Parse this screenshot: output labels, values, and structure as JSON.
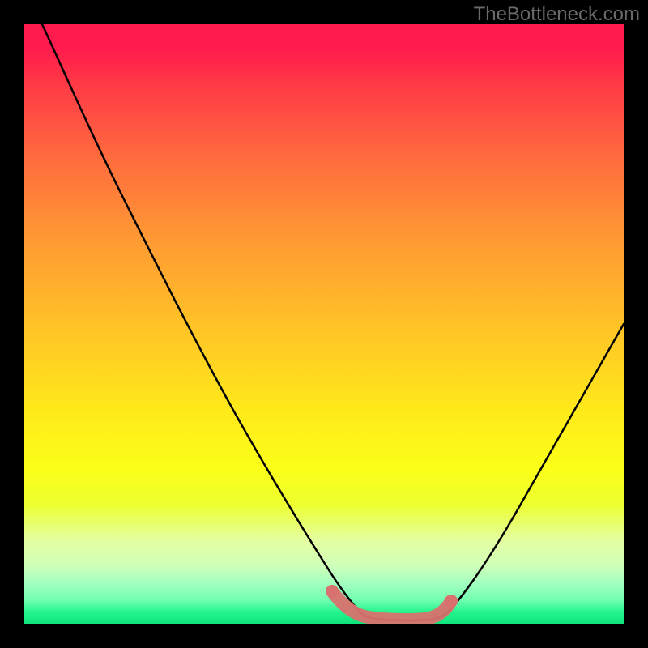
{
  "watermark": "TheBottleneck.com",
  "chart_data": {
    "type": "line",
    "title": "",
    "xlabel": "",
    "ylabel": "",
    "xlim": [
      0,
      1
    ],
    "ylim": [
      0,
      1
    ],
    "description": "Bottleneck curve: V-shaped performance curve on a vertical spectrum gradient (red = high bottleneck near top, green = low bottleneck near bottom). No numeric axis ticks are shown.",
    "series": [
      {
        "name": "bottleneck-curve",
        "color": "#000000",
        "x": [
          0.03,
          0.08,
          0.15,
          0.22,
          0.3,
          0.38,
          0.45,
          0.51,
          0.55,
          0.58,
          0.62,
          0.66,
          0.7,
          0.76,
          0.84,
          0.92,
          1.0
        ],
        "y": [
          1.0,
          0.9,
          0.76,
          0.62,
          0.46,
          0.3,
          0.16,
          0.06,
          0.02,
          0.01,
          0.01,
          0.01,
          0.02,
          0.06,
          0.16,
          0.3,
          0.46
        ]
      },
      {
        "name": "highlight-band",
        "color": "#d9716e",
        "x": [
          0.51,
          0.55,
          0.58,
          0.62,
          0.66,
          0.7
        ],
        "y": [
          0.045,
          0.02,
          0.01,
          0.01,
          0.015,
          0.035
        ]
      }
    ]
  }
}
